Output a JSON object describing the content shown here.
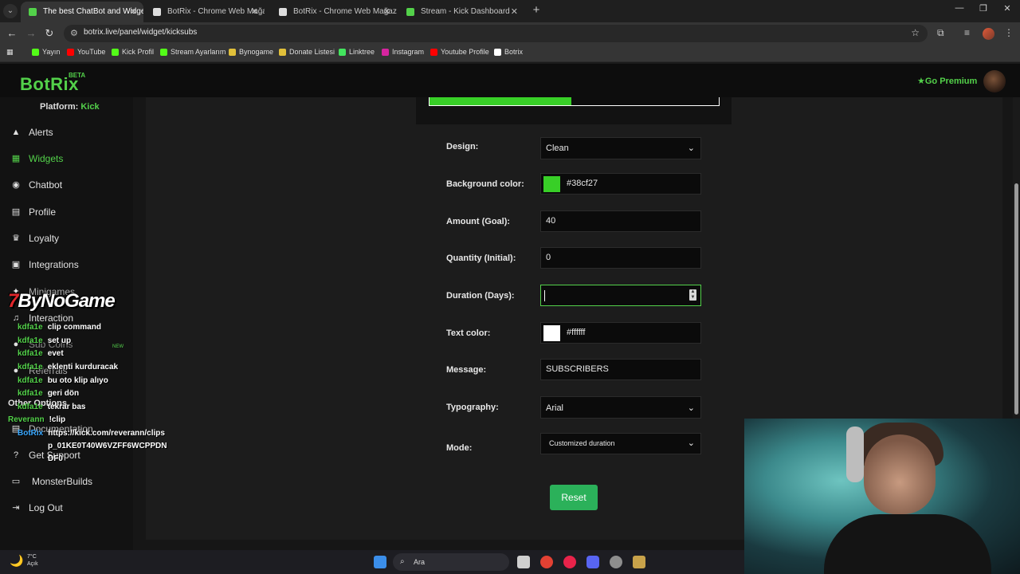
{
  "browser": {
    "tabs": [
      {
        "title": "The best ChatBot and Widgets",
        "color": "#53d14a",
        "active": true
      },
      {
        "title": "BotRix - Chrome Web Mağazası",
        "color": "#dddddd",
        "active": false
      },
      {
        "title": "BotRix - Chrome Web Mağazası",
        "color": "#dddddd",
        "active": false
      },
      {
        "title": "Stream - Kick Dashboard",
        "color": "#53d14a",
        "active": false
      }
    ],
    "url": "botrix.live/panel/widget/kicksubs",
    "bookmarks": [
      {
        "label": "Yayın",
        "color": "#53fc18"
      },
      {
        "label": "YouTube",
        "color": "#ff0000"
      },
      {
        "label": "Kick Profil",
        "color": "#53fc18"
      },
      {
        "label": "Stream Ayarlarım",
        "color": "#53fc18"
      },
      {
        "label": "Bynogame",
        "color": "#e1c03a"
      },
      {
        "label": "Donate Listesi",
        "color": "#e1c03a"
      },
      {
        "label": "Linktree",
        "color": "#43e55e"
      },
      {
        "label": "Instagram",
        "color": "#d6249f"
      },
      {
        "label": "Youtube Profile",
        "color": "#ff0000"
      },
      {
        "label": "Botrix",
        "color": "#ffffff"
      }
    ]
  },
  "header": {
    "logo": "BotRix",
    "beta": "BETA",
    "premium": "Go Premium"
  },
  "sidebar": {
    "platform_label": "Platform:",
    "platform_value": "Kick",
    "items": [
      {
        "label": "Alerts",
        "icon": "warning-icon"
      },
      {
        "label": "Widgets",
        "icon": "grid-icon"
      },
      {
        "label": "Chatbot",
        "icon": "robot-icon"
      },
      {
        "label": "Profile",
        "icon": "id-card-icon"
      },
      {
        "label": "Loyalty",
        "icon": "trophy-icon"
      },
      {
        "label": "Integrations",
        "icon": "integrations-icon"
      },
      {
        "label": "Minigames",
        "icon": "gamepad-icon"
      },
      {
        "label": "Interaction",
        "icon": "music-icon"
      },
      {
        "label": "Sub Coins",
        "icon": "coins-icon"
      },
      {
        "label": "Referrals",
        "icon": "user-icon"
      },
      {
        "label": "Other Options",
        "icon": ""
      },
      {
        "label": "Documentation",
        "icon": "book-icon"
      },
      {
        "label": "Get Support",
        "icon": "help-icon"
      },
      {
        "label": "MonsterBuilds",
        "icon": "laptop-icon"
      },
      {
        "label": "Log Out",
        "icon": "logout-icon"
      }
    ],
    "new_badge": "NEW"
  },
  "chat_overlay": {
    "brand": "ByNoGame",
    "messages": [
      {
        "user": "kdfa1e",
        "text": "clip command",
        "color": "#53d14a"
      },
      {
        "user": "kdfa1e",
        "text": "set up",
        "color": "#53d14a"
      },
      {
        "user": "kdfa1e",
        "text": "evet",
        "color": "#53d14a"
      },
      {
        "user": "kdfa1e",
        "text": "eklenti kurduracak",
        "color": "#53d14a"
      },
      {
        "user": "kdfa1e",
        "text": "bu oto klip alıyo",
        "color": "#53d14a"
      },
      {
        "user": "kdfa1e",
        "text": "geri dön",
        "color": "#53d14a"
      },
      {
        "user": "kdfa1e",
        "text": "tekrar bas",
        "color": "#53d14a"
      },
      {
        "user": "Reverann",
        "text": "!clip",
        "color": "#53d14a"
      },
      {
        "user": "BotRix",
        "text": "https://kick.com/reverann/clips",
        "color": "#3aa8ff"
      },
      {
        "user": "",
        "text": "p_01KE0T40W6VZFF6WCPPDN",
        "color": "#ffffff"
      },
      {
        "user": "",
        "text": "DF0",
        "color": "#ffffff"
      }
    ]
  },
  "form": {
    "design_label": "Design:",
    "design_value": "Clean",
    "bg_label": "Background color:",
    "bg_value": "#38cf27",
    "bg_color": "#38cf27",
    "amount_label": "Amount (Goal):",
    "amount_value": "40",
    "quantity_label": "Quantity (Initial):",
    "quantity_value": "0",
    "duration_label": "Duration (Days):",
    "duration_value": "",
    "text_color_label": "Text color:",
    "text_color_value": "#ffffff",
    "text_color": "#ffffff",
    "message_label": "Message:",
    "message_value": "SUBSCRIBERS",
    "typography_label": "Typography:",
    "typography_value": "Arial",
    "mode_label": "Mode:",
    "mode_value": "Customized duration",
    "reset_label": "Reset"
  },
  "preview": {
    "progress_fraction": 0.49,
    "fill_color": "#38cf27"
  },
  "taskbar": {
    "temperature": "7°C",
    "condition": "Açık",
    "search_placeholder": "Ara"
  }
}
